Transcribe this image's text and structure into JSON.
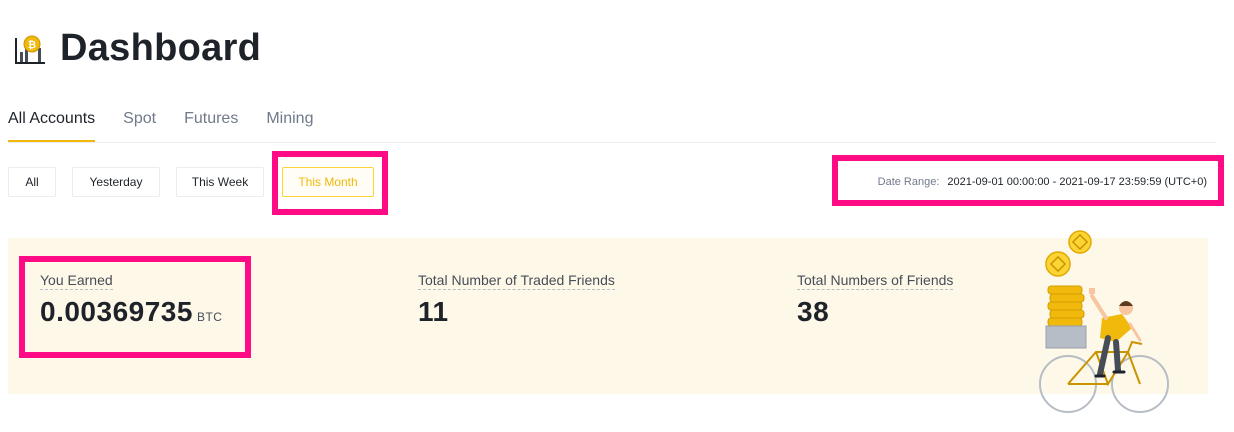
{
  "header": {
    "title": "Dashboard",
    "icon": "chart-coin-icon"
  },
  "tabs": [
    {
      "label": "All Accounts",
      "active": true
    },
    {
      "label": "Spot",
      "active": false
    },
    {
      "label": "Futures",
      "active": false
    },
    {
      "label": "Mining",
      "active": false
    }
  ],
  "filters": {
    "all": "All",
    "yesterday": "Yesterday",
    "this_week": "This Week",
    "this_month": "This Month",
    "selected": "This Month"
  },
  "date_range": {
    "label": "Date Range:",
    "value": "2021-09-01 00:00:00 - 2021-09-17 23:59:59 (UTC+0)"
  },
  "stats": {
    "earned": {
      "label": "You Earned",
      "value": "0.00369735",
      "unit": "BTC"
    },
    "traded_friends": {
      "label": "Total Number of Traded Friends",
      "value": "11"
    },
    "friends": {
      "label": "Total Numbers of Friends",
      "value": "38"
    }
  },
  "illustration": {
    "icon": "cyclist-with-coins-illustration"
  },
  "colors": {
    "accent": "#f0b90b",
    "highlight": "#ff0b86",
    "panel_bg": "#fef8e9"
  }
}
